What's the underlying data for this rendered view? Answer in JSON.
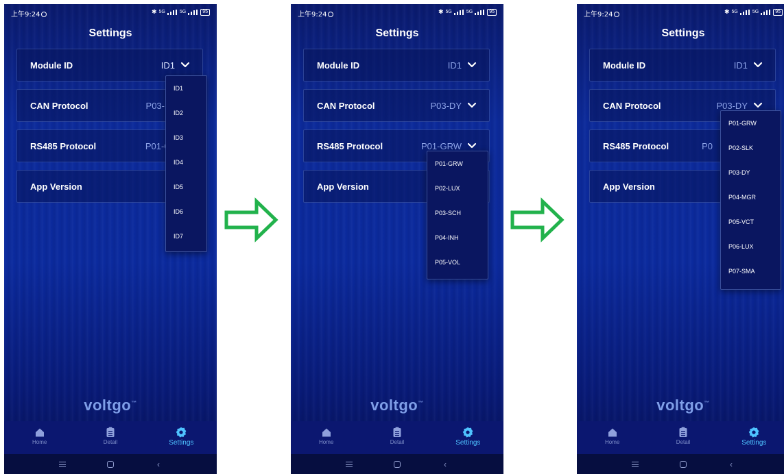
{
  "status_bar": {
    "time": "上午9:24",
    "network": "5G",
    "battery": "95"
  },
  "screen_title": "Settings",
  "rows": {
    "module_id": {
      "label": "Module ID"
    },
    "can_protocol": {
      "label": "CAN Protocol"
    },
    "rs485_protocol": {
      "label": "RS485 Protocol"
    },
    "app_version": {
      "label": "App Version"
    }
  },
  "screens": [
    {
      "values": {
        "module_id": "ID1",
        "can_protocol": "P03-",
        "rs485_protocol": "P01-GI"
      },
      "dropdown": {
        "field": "Module ID",
        "options": [
          "ID1",
          "ID2",
          "ID3",
          "ID4",
          "ID5",
          "ID6",
          "ID7"
        ]
      }
    },
    {
      "values": {
        "module_id": "ID1",
        "can_protocol": "P03-DY",
        "rs485_protocol": "P01-GRW"
      },
      "dropdown": {
        "field": "RS485 Protocol",
        "options": [
          "P01-GRW",
          "P02-LUX",
          "P03-SCH",
          "P04-INH",
          "P05-VOL"
        ]
      }
    },
    {
      "values": {
        "module_id": "ID1",
        "can_protocol": "P03-DY",
        "rs485_protocol": "P0"
      },
      "dropdown": {
        "field": "CAN Protocol",
        "options": [
          "P01-GRW",
          "P02-SLK",
          "P03-DY",
          "P04-MGR",
          "P05-VCT",
          "P06-LUX",
          "P07-SMA"
        ]
      }
    }
  ],
  "brand": "voltgo",
  "bottom_nav": [
    {
      "label": "Home",
      "icon": "home-icon",
      "active": false
    },
    {
      "label": "Detail",
      "icon": "clipboard-icon",
      "active": false
    },
    {
      "label": "Settings",
      "icon": "gear-icon",
      "active": true
    }
  ],
  "colors": {
    "background_top": "#0a1a6e",
    "background_mid": "#0c2a9a",
    "row_value": "#8ea4e8",
    "nav_active": "#4fc3ff",
    "arrow": "#22b24c"
  }
}
